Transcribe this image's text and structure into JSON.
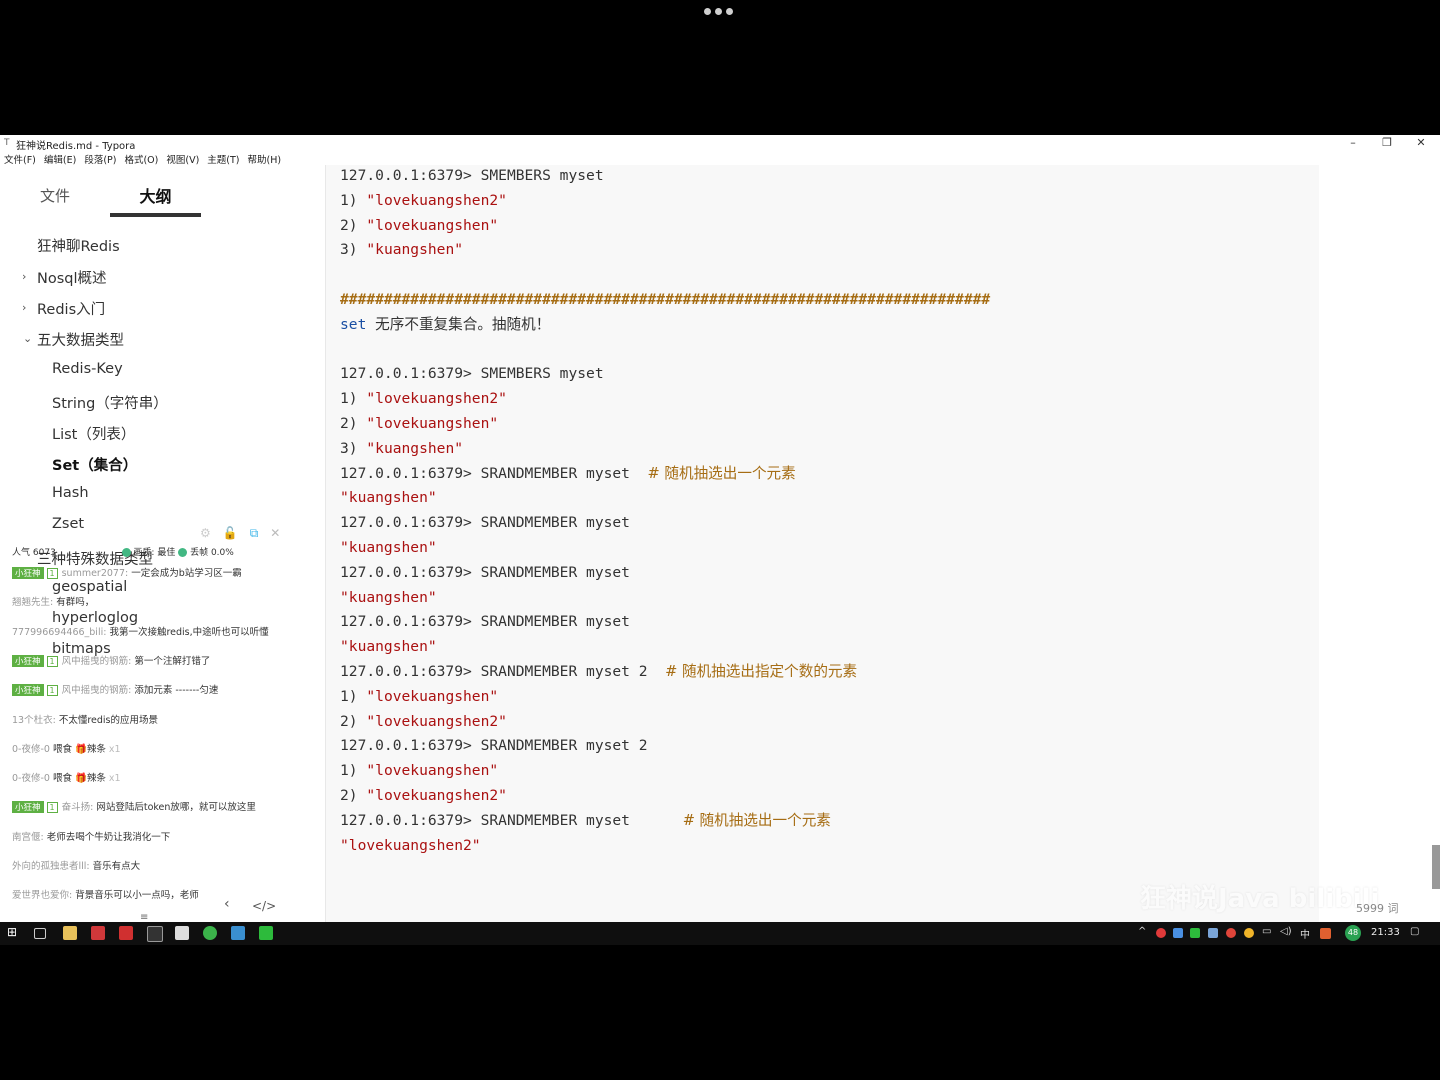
{
  "window": {
    "title": "狂神说Redis.md - Typora",
    "menu": [
      "文件(F)",
      "编辑(E)",
      "段落(P)",
      "格式(O)",
      "视图(V)",
      "主题(T)",
      "帮助(H)"
    ]
  },
  "sidebar": {
    "tab_files": "文件",
    "tab_outline": "大纲",
    "outline": [
      {
        "label": "狂神聊Redis",
        "level": 0
      },
      {
        "label": "Nosql概述",
        "level": 1,
        "collapsed": true
      },
      {
        "label": "Redis入门",
        "level": 1,
        "collapsed": true
      },
      {
        "label": "五大数据类型",
        "level": 1,
        "expanded": true
      },
      {
        "label": "Redis-Key",
        "level": 2
      },
      {
        "label": "String（字符串）",
        "level": 2
      },
      {
        "label": "List（列表）",
        "level": 2
      },
      {
        "label": "Set（集合）",
        "level": 2,
        "active": true
      },
      {
        "label": "Hash",
        "level": 2
      },
      {
        "label": "Zset",
        "level": 2
      },
      {
        "label": "三种特殊数据类型",
        "level": 1
      },
      {
        "label": "geospatial",
        "level": 2
      },
      {
        "label": "hyperloglog",
        "level": 2
      },
      {
        "label": "bitmaps",
        "level": 2
      }
    ]
  },
  "chat": {
    "status": {
      "popularity_label": "人气",
      "popularity": "6073",
      "quality_label": "画质: 最佳",
      "drop_label": "丢帧 0.0%"
    },
    "messages": [
      {
        "badge": "小狂神",
        "lvl": "1",
        "name": "summer2077:",
        "text": "一定会成为b站学习区一霸"
      },
      {
        "name": "翘翘先生:",
        "text": "有群吗，"
      },
      {
        "name": "777996694466_bili:",
        "text": "我第一次接触redis,中途听也可以听懂"
      },
      {
        "badge": "小狂神",
        "lvl": "1",
        "name": "风中摇曳的钢筋:",
        "text": "第一个注解打错了"
      },
      {
        "badge": "小狂神",
        "lvl": "1",
        "name": "风中摇曳的钢筋:",
        "text": "添加元素  -------匀速"
      },
      {
        "name": "13个杜衣:",
        "text": "不太懂redis的应用场景"
      },
      {
        "name": "0-夜修-0",
        "text": "喂食",
        "gift": "辣条",
        "mult": "x1"
      },
      {
        "name": "0-夜修-0",
        "text": "喂食",
        "gift": "辣条",
        "mult": "x1"
      },
      {
        "badge": "小狂神",
        "lvl": "1",
        "name": "奋斗扬:",
        "text": "网站登陆后token放哪，就可以放这里"
      },
      {
        "name": "南宫偃:",
        "text": "老师去喝个牛奶让我消化一下"
      },
      {
        "name": "外向的孤独患者lll:",
        "text": "音乐有点大"
      },
      {
        "name": "爱世界也爱你:",
        "text": "背景音乐可以小一点吗，老师"
      }
    ]
  },
  "editor": {
    "lines": [
      {
        "type": "cmd",
        "prompt": "127.0.0.1:6379>",
        "cmd": "SMEMBERS myset"
      },
      {
        "type": "item",
        "n": "1)",
        "val": "\"lovekuangshen2\""
      },
      {
        "type": "item",
        "n": "2)",
        "val": "\"lovekuangshen\""
      },
      {
        "type": "item",
        "n": "3)",
        "val": "\"kuangshen\""
      },
      {
        "type": "blank"
      },
      {
        "type": "hash",
        "text": "##########################################################################"
      },
      {
        "type": "heading",
        "kw": "set",
        "text": "无序不重复集合。抽随机！"
      },
      {
        "type": "blank"
      },
      {
        "type": "cmd",
        "prompt": "127.0.0.1:6379>",
        "cmd": "SMEMBERS myset"
      },
      {
        "type": "item",
        "n": "1)",
        "val": "\"lovekuangshen2\""
      },
      {
        "type": "item",
        "n": "2)",
        "val": "\"lovekuangshen\""
      },
      {
        "type": "item",
        "n": "3)",
        "val": "\"kuangshen\""
      },
      {
        "type": "cmd",
        "prompt": "127.0.0.1:6379>",
        "cmd": "SRANDMEMBER myset  ",
        "comment": "# 随机抽选出一个元素"
      },
      {
        "type": "str",
        "val": "\"kuangshen\""
      },
      {
        "type": "cmd",
        "prompt": "127.0.0.1:6379>",
        "cmd": "SRANDMEMBER myset"
      },
      {
        "type": "str",
        "val": "\"kuangshen\""
      },
      {
        "type": "cmd",
        "prompt": "127.0.0.1:6379>",
        "cmd": "SRANDMEMBER myset"
      },
      {
        "type": "str",
        "val": "\"kuangshen\""
      },
      {
        "type": "cmd",
        "prompt": "127.0.0.1:6379>",
        "cmd": "SRANDMEMBER myset"
      },
      {
        "type": "str",
        "val": "\"kuangshen\""
      },
      {
        "type": "cmd",
        "prompt": "127.0.0.1:6379>",
        "cmd": "SRANDMEMBER myset 2  ",
        "comment": "# 随机抽选出指定个数的元素"
      },
      {
        "type": "item",
        "n": "1)",
        "val": "\"lovekuangshen\""
      },
      {
        "type": "item",
        "n": "2)",
        "val": "\"lovekuangshen2\""
      },
      {
        "type": "cmd",
        "prompt": "127.0.0.1:6379>",
        "cmd": "SRANDMEMBER myset 2"
      },
      {
        "type": "item",
        "n": "1)",
        "val": "\"lovekuangshen\""
      },
      {
        "type": "item",
        "n": "2)",
        "val": "\"lovekuangshen2\""
      },
      {
        "type": "cmd",
        "prompt": "127.0.0.1:6379>",
        "cmd": "SRANDMEMBER myset      ",
        "comment": "# 随机抽选出一个元素"
      },
      {
        "type": "str",
        "val": "\"lovekuangshen2\""
      }
    ],
    "word_count": "5999 词"
  },
  "watermark": "狂神说Java bilibili",
  "taskbar": {
    "clock": "21:33",
    "ime": "中",
    "badge": "48"
  }
}
